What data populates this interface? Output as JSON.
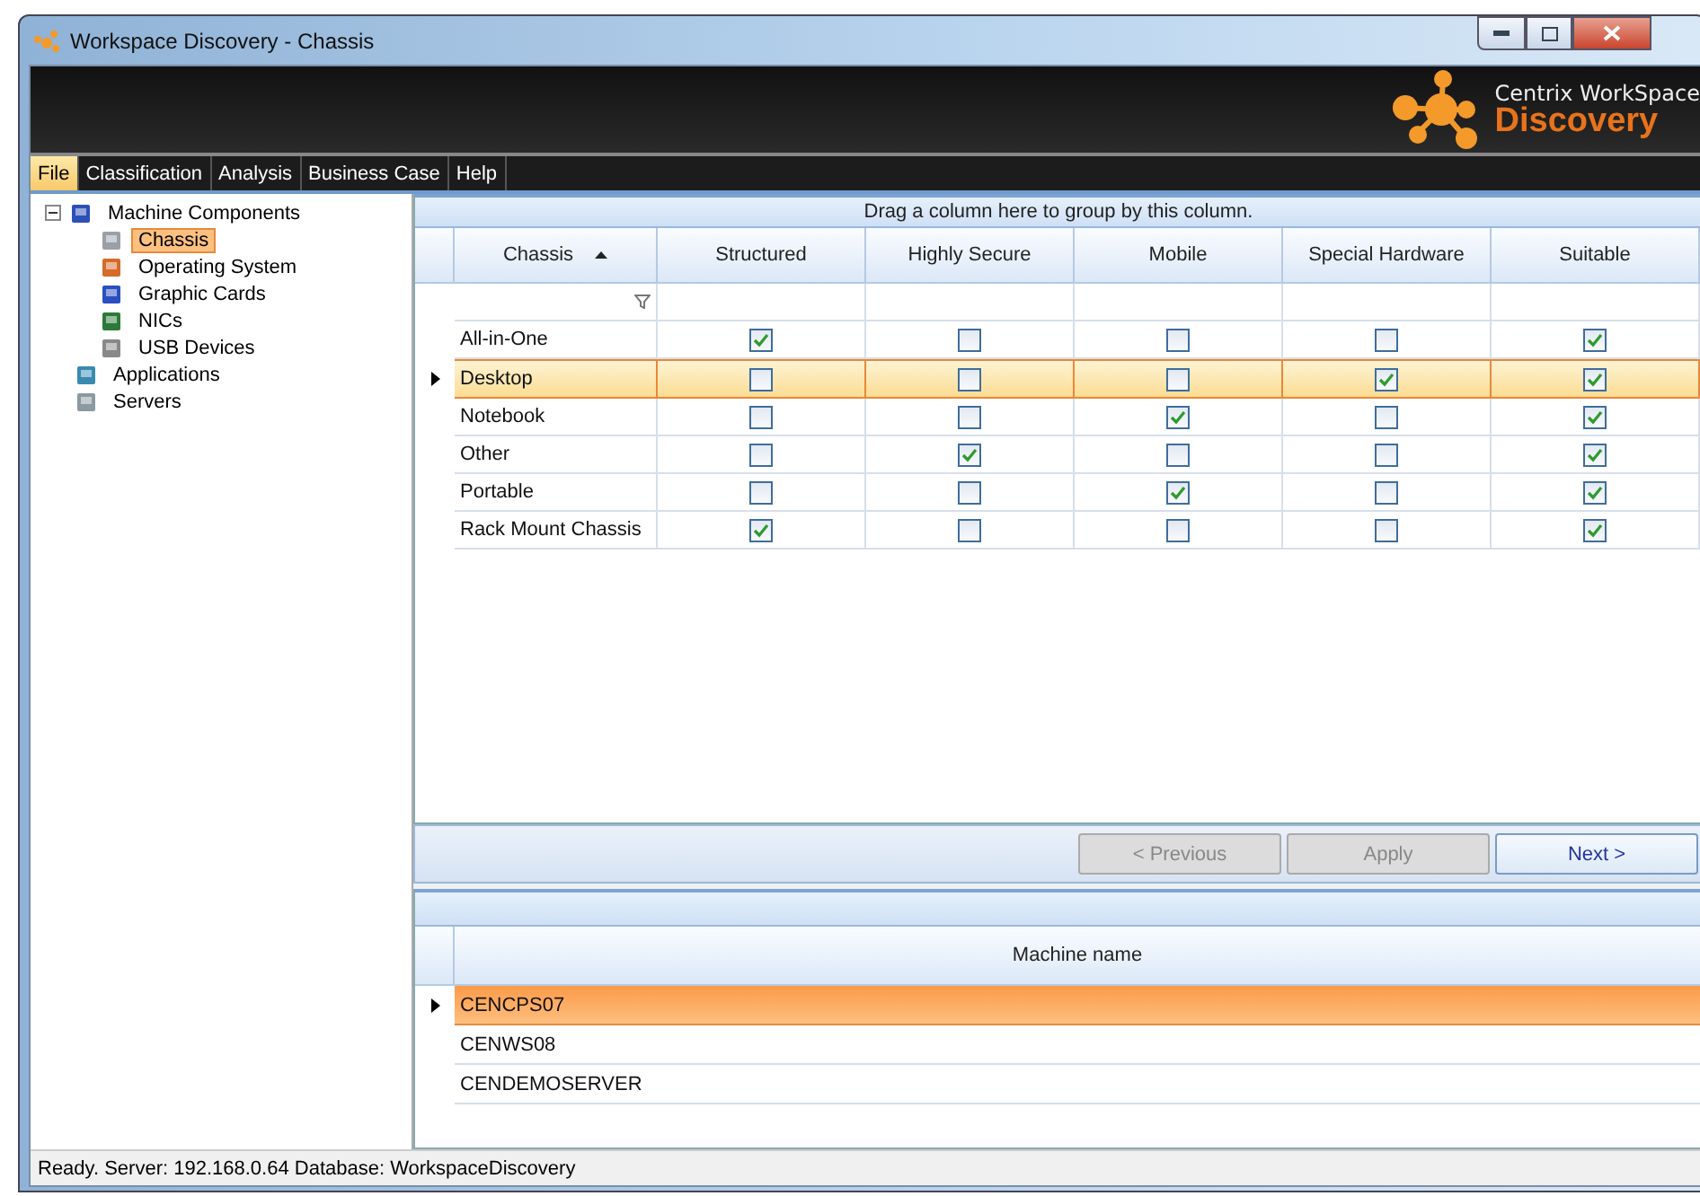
{
  "window": {
    "title": "Workspace Discovery - Chassis"
  },
  "brand": {
    "line1": "Centrix WorkSpace",
    "line2": "Discovery"
  },
  "menu": [
    {
      "label": "File",
      "selected": true
    },
    {
      "label": "Classification",
      "selected": false
    },
    {
      "label": "Analysis",
      "selected": false
    },
    {
      "label": "Business Case",
      "selected": false
    },
    {
      "label": "Help",
      "selected": false
    }
  ],
  "tree": [
    {
      "label": "Machine Components",
      "kind": "components",
      "expanded": true,
      "selected": false,
      "children": [
        {
          "label": "Chassis",
          "kind": "chassis",
          "selected": true
        },
        {
          "label": "Operating System",
          "kind": "os",
          "selected": false
        },
        {
          "label": "Graphic Cards",
          "kind": "monitor",
          "selected": false
        },
        {
          "label": "NICs",
          "kind": "card",
          "selected": false
        },
        {
          "label": "USB Devices",
          "kind": "usb",
          "selected": false
        }
      ]
    },
    {
      "label": "Applications",
      "kind": "apps",
      "selected": false
    },
    {
      "label": "Servers",
      "kind": "server",
      "selected": false
    }
  ],
  "grid": {
    "group_hint": "Drag a column here to group by this column.",
    "columns": [
      {
        "label": "Chassis",
        "sorted": true
      },
      {
        "label": "Structured"
      },
      {
        "label": "Highly Secure"
      },
      {
        "label": "Mobile"
      },
      {
        "label": "Special Hardware"
      },
      {
        "label": "Suitable"
      }
    ],
    "rows": [
      {
        "name": "All-in-One",
        "selected": false,
        "checks": [
          true,
          false,
          false,
          false,
          true
        ]
      },
      {
        "name": "Desktop",
        "selected": true,
        "checks": [
          false,
          false,
          false,
          true,
          true
        ]
      },
      {
        "name": "Notebook",
        "selected": false,
        "checks": [
          false,
          false,
          true,
          false,
          true
        ]
      },
      {
        "name": "Other",
        "selected": false,
        "checks": [
          false,
          true,
          false,
          false,
          true
        ]
      },
      {
        "name": "Portable",
        "selected": false,
        "checks": [
          false,
          false,
          true,
          false,
          true
        ]
      },
      {
        "name": "Rack Mount Chassis",
        "selected": false,
        "checks": [
          true,
          false,
          false,
          false,
          true
        ]
      }
    ]
  },
  "buttons": [
    {
      "label": "< Previous",
      "disabled": true
    },
    {
      "label": "Apply",
      "disabled": true
    },
    {
      "label": "Next >",
      "disabled": false
    }
  ],
  "machines": {
    "column": "Machine name",
    "rows": [
      {
        "name": "CENCPS07",
        "selected": true
      },
      {
        "name": "CENWS08",
        "selected": false
      },
      {
        "name": "CENDEMOSERVER",
        "selected": false
      }
    ]
  },
  "status_bar": "Ready.  Server: 192.168.0.64 Database: WorkspaceDiscovery"
}
